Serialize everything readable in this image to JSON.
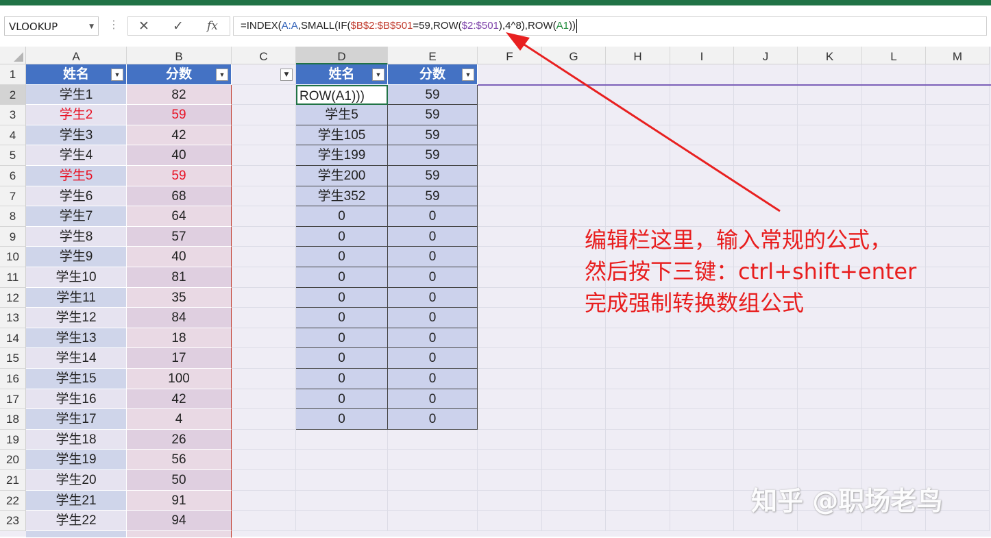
{
  "formula_bar": {
    "name_box": "VLOOKUP",
    "more_icon": "vertical-dots-icon",
    "cancel_icon": "close-icon",
    "enter_icon": "check-icon",
    "fx_label": "fx",
    "formula_parts": [
      {
        "text": "=INDEX(",
        "color": "#222222"
      },
      {
        "text": "A:A",
        "color": "#2e5fb7"
      },
      {
        "text": ",SMALL(IF(",
        "color": "#222222"
      },
      {
        "text": "$B$2:$B$501",
        "color": "#c0392b"
      },
      {
        "text": "=59,ROW(",
        "color": "#222222"
      },
      {
        "text": "$2:$501",
        "color": "#7b3fa8"
      },
      {
        "text": "),4^8),ROW(",
        "color": "#222222"
      },
      {
        "text": "A1",
        "color": "#1e8a3a"
      },
      {
        "text": "))",
        "color": "#222222"
      }
    ]
  },
  "columns": [
    "A",
    "B",
    "C",
    "D",
    "E",
    "F",
    "G",
    "H",
    "I",
    "J",
    "K",
    "L",
    "M"
  ],
  "rows": [
    "1",
    "2",
    "3",
    "4",
    "5",
    "6",
    "7",
    "8",
    "9",
    "10",
    "11",
    "12",
    "13",
    "14",
    "15",
    "16",
    "17",
    "18",
    "19",
    "20",
    "21",
    "22",
    "23"
  ],
  "table1": {
    "headers": [
      "姓名",
      "分数"
    ],
    "rows": [
      [
        "学生1",
        "82"
      ],
      [
        "学生2",
        "59"
      ],
      [
        "学生3",
        "42"
      ],
      [
        "学生4",
        "40"
      ],
      [
        "学生5",
        "59"
      ],
      [
        "学生6",
        "68"
      ],
      [
        "学生7",
        "64"
      ],
      [
        "学生8",
        "57"
      ],
      [
        "学生9",
        "40"
      ],
      [
        "学生10",
        "81"
      ],
      [
        "学生11",
        "35"
      ],
      [
        "学生12",
        "84"
      ],
      [
        "学生13",
        "18"
      ],
      [
        "学生14",
        "17"
      ],
      [
        "学生15",
        "100"
      ],
      [
        "学生16",
        "42"
      ],
      [
        "学生17",
        "4"
      ],
      [
        "学生18",
        "26"
      ],
      [
        "学生19",
        "56"
      ],
      [
        "学生20",
        "50"
      ],
      [
        "学生21",
        "91"
      ],
      [
        "学生22",
        "94"
      ]
    ],
    "highlight_color": "#e81123",
    "highlight_rows": [
      1,
      4
    ]
  },
  "table2": {
    "headers": [
      "姓名",
      "分数"
    ],
    "rows": [
      [
        "ROW(A1)))",
        "59"
      ],
      [
        "学生5",
        "59"
      ],
      [
        "学生105",
        "59"
      ],
      [
        "学生199",
        "59"
      ],
      [
        "学生200",
        "59"
      ],
      [
        "学生352",
        "59"
      ],
      [
        "0",
        "0"
      ],
      [
        "0",
        "0"
      ],
      [
        "0",
        "0"
      ],
      [
        "0",
        "0"
      ],
      [
        "0",
        "0"
      ],
      [
        "0",
        "0"
      ],
      [
        "0",
        "0"
      ],
      [
        "0",
        "0"
      ],
      [
        "0",
        "0"
      ],
      [
        "0",
        "0"
      ],
      [
        "0",
        "0"
      ]
    ]
  },
  "annotation": {
    "lines": [
      "编辑栏这里，输入常规的公式，",
      "然后按下三键：ctrl+shift+enter",
      "完成强制转换数组公式"
    ],
    "color": "#e81e1e"
  },
  "watermark": "知乎 @职场老鸟",
  "colors": {
    "table_header": "#4472c4",
    "excel_green": "#217346",
    "arrow": "#e82020"
  }
}
